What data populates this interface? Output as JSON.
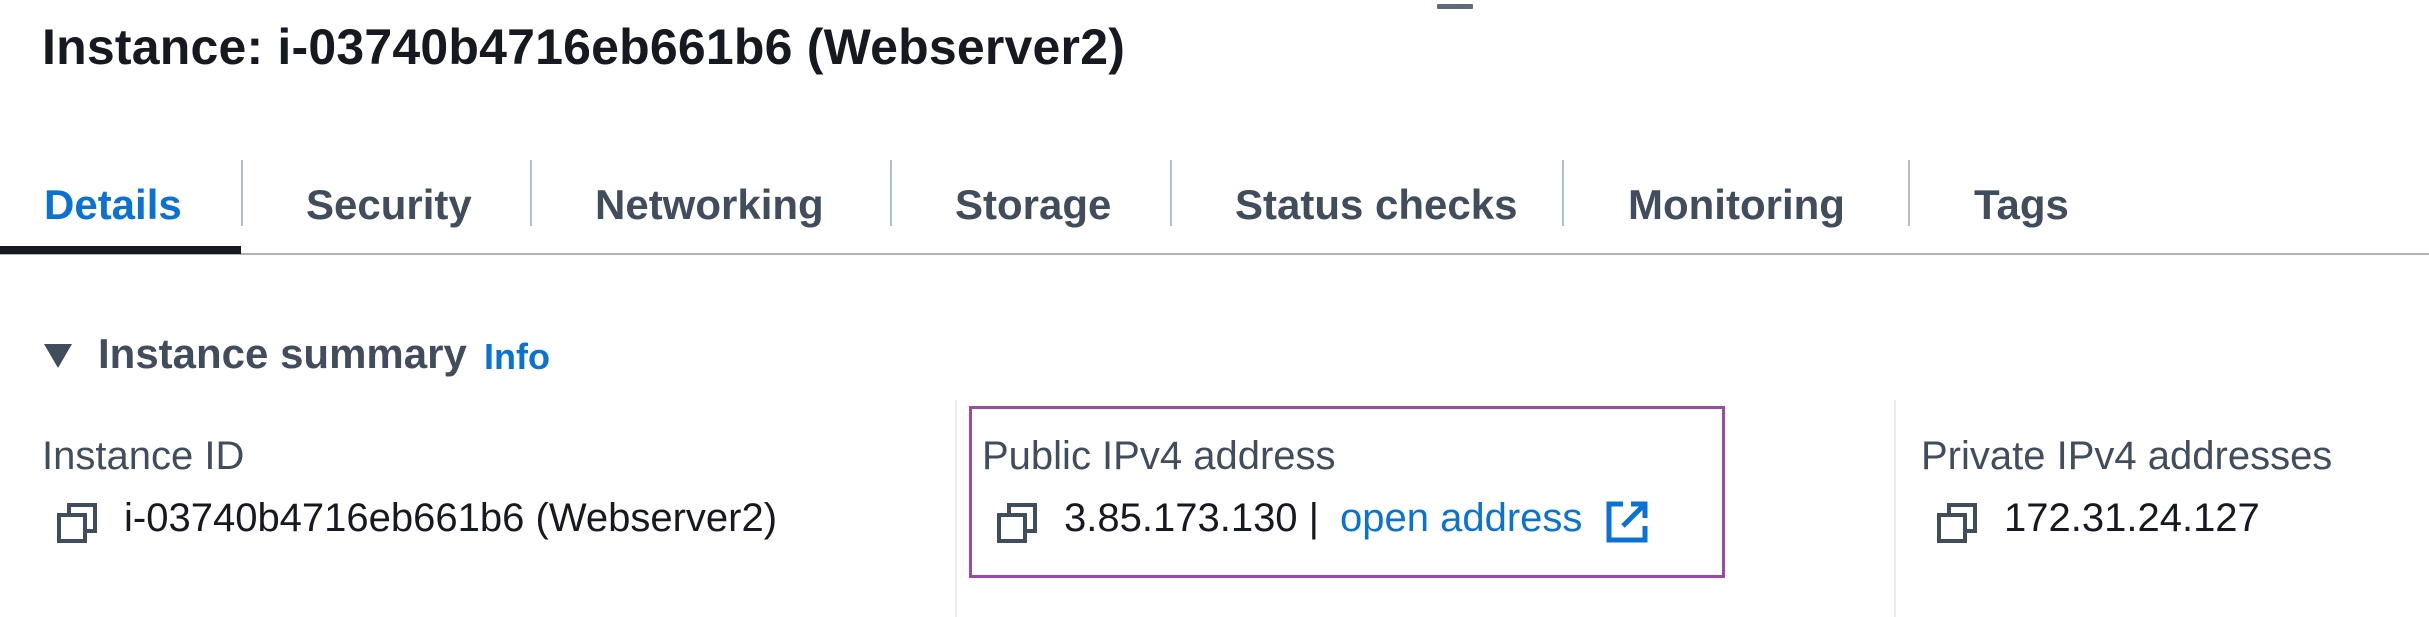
{
  "instance": {
    "title": "Instance: i-03740b4716eb661b6 (Webserver2)"
  },
  "tabs": [
    {
      "label": "Details",
      "active": true
    },
    {
      "label": "Security",
      "active": false
    },
    {
      "label": "Networking",
      "active": false
    },
    {
      "label": "Storage",
      "active": false
    },
    {
      "label": "Status checks",
      "active": false
    },
    {
      "label": "Monitoring",
      "active": false
    },
    {
      "label": "Tags",
      "active": false
    }
  ],
  "summary": {
    "title": "Instance summary",
    "info_label": "Info",
    "instance_id": {
      "label": "Instance ID",
      "value": "i-03740b4716eb661b6 (Webserver2)"
    },
    "public_ipv4": {
      "label": "Public IPv4 address",
      "value": "3.85.173.130 |",
      "link_label": "open address"
    },
    "private_ipv4": {
      "label": "Private IPv4 addresses",
      "value": "172.31.24.127"
    }
  },
  "colors": {
    "accent": "#0972d3",
    "highlight": "#9b4aa6",
    "text": "#16191f",
    "muted": "#414d5c"
  },
  "icons": {
    "copy": "copy-icon",
    "external": "external-link-icon",
    "toggle": "caret-down-icon"
  }
}
